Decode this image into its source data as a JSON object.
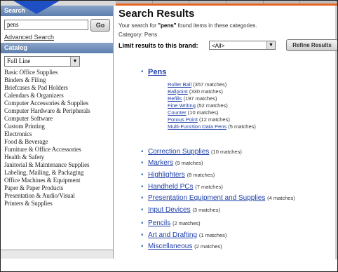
{
  "sidebar": {
    "search_heading": "Search",
    "search_value": "pens",
    "go_label": "Go",
    "advanced_search": "Advanced Search",
    "catalog_heading": "Catalog",
    "catalog_select": "Full Line",
    "categories": [
      "Basic Office Supplies",
      "Binders & Filing",
      "Briefcases & Pad Holders",
      "Calendars & Organizers",
      "Computer Accessories & Supplies",
      "Computer Hardware & Peripherals",
      "Computer Software",
      "Custom Printing",
      "Electronics",
      "Food & Beverage",
      "Furniture & Office Accessories",
      "Health & Safety",
      "Janitorial & Maintenance Supplies",
      "Labeling, Mailing, & Packaging",
      "Office Machines & Equipment",
      "Paper & Paper Products",
      "Presentation & Audio/Visual",
      "Printers & Supplies"
    ]
  },
  "main": {
    "title": "Search Results",
    "summary_prefix": "Your search for ",
    "summary_term": "\"pens\"",
    "summary_suffix": " found items in these categories.",
    "category_line": "Category: Pens",
    "brand_label": "Limit results to this brand:",
    "brand_select": "<All>",
    "refine_label": "Refine Results",
    "top_result": {
      "label": "Pens",
      "subs": [
        {
          "label": "Roller Ball",
          "count": "(357 matches)"
        },
        {
          "label": "Ballpoint",
          "count": "(330 matches)"
        },
        {
          "label": "Refills",
          "count": "(197 matches)"
        },
        {
          "label": "Fine Writing",
          "count": "(52 matches)"
        },
        {
          "label": "Counter",
          "count": "(10 matches)"
        },
        {
          "label": "Porous Point",
          "count": "(12 matches)"
        },
        {
          "label": "Multi-Function Data Pens",
          "count": "(5 matches)"
        }
      ]
    },
    "results": [
      {
        "label": "Correction Supplies",
        "count": "(10 matches)"
      },
      {
        "label": "Markers",
        "count": "(9 matches)"
      },
      {
        "label": "Highlighters",
        "count": "(8 matches)"
      },
      {
        "label": "Handheld PCs",
        "count": "(7 matches)"
      },
      {
        "label": "Presentation Equipment and Supplies",
        "count": "(4 matches)"
      },
      {
        "label": "Input Devices",
        "count": "(3 matches)"
      },
      {
        "label": "Pencils",
        "count": "(2 matches)"
      },
      {
        "label": "Art and Drafting",
        "count": "(1 matches)"
      },
      {
        "label": "Miscellaneous",
        "count": "(2 matches)"
      }
    ]
  },
  "icons": {
    "dropdown": "chevron-down-icon",
    "bullet": "bullet-icon",
    "pointer": "arrow-pointer-icon"
  },
  "colors": {
    "link": "#1e3fa8",
    "sidebar_header": "#6f8db9",
    "accent_bar": "#e8641e",
    "pointer": "#1f4fc4"
  }
}
